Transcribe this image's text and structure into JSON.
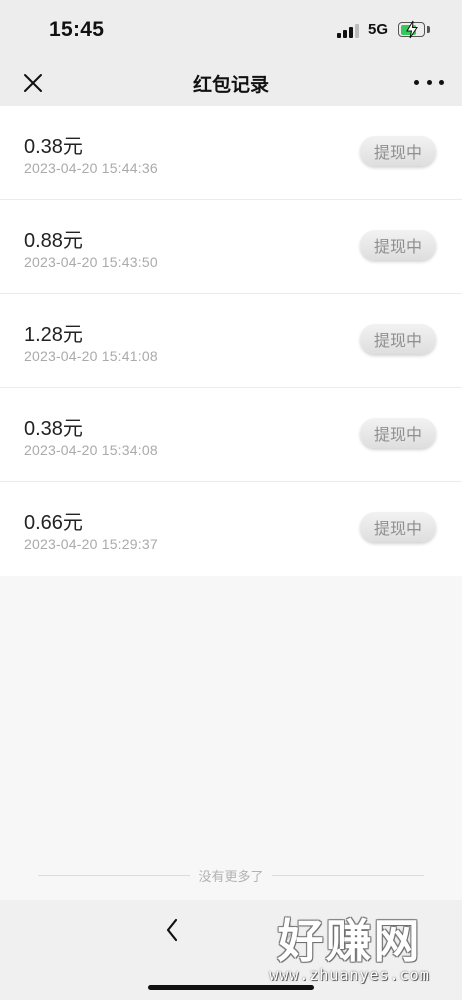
{
  "status_bar": {
    "time": "15:45",
    "network": "5G",
    "icons": [
      "signal-icon",
      "battery-charging-icon"
    ],
    "battery_level": 0.75
  },
  "nav": {
    "title": "红包记录",
    "close_icon": "close-icon",
    "more_icon": "more-icon"
  },
  "records": [
    {
      "amount": "0.38元",
      "time": "2023-04-20 15:44:36",
      "status": "提现中"
    },
    {
      "amount": "0.88元",
      "time": "2023-04-20 15:43:50",
      "status": "提现中"
    },
    {
      "amount": "1.28元",
      "time": "2023-04-20 15:41:08",
      "status": "提现中"
    },
    {
      "amount": "0.38元",
      "time": "2023-04-20 15:34:08",
      "status": "提现中"
    },
    {
      "amount": "0.66元",
      "time": "2023-04-20 15:29:37",
      "status": "提现中"
    }
  ],
  "list_end_text": "没有更多了",
  "bottom_nav": {
    "back_icon": "chevron-left-icon",
    "forward_icon": "chevron-right-icon"
  },
  "watermark": {
    "logo": "好赚网",
    "url": "www.zhuanyes.com"
  },
  "colors": {
    "nav_background": "#ededed",
    "list_background": "#ffffff",
    "page_background": "#f7f7f7",
    "battery_fill": "#34c759",
    "status_button_text": "#8f8f8f"
  }
}
